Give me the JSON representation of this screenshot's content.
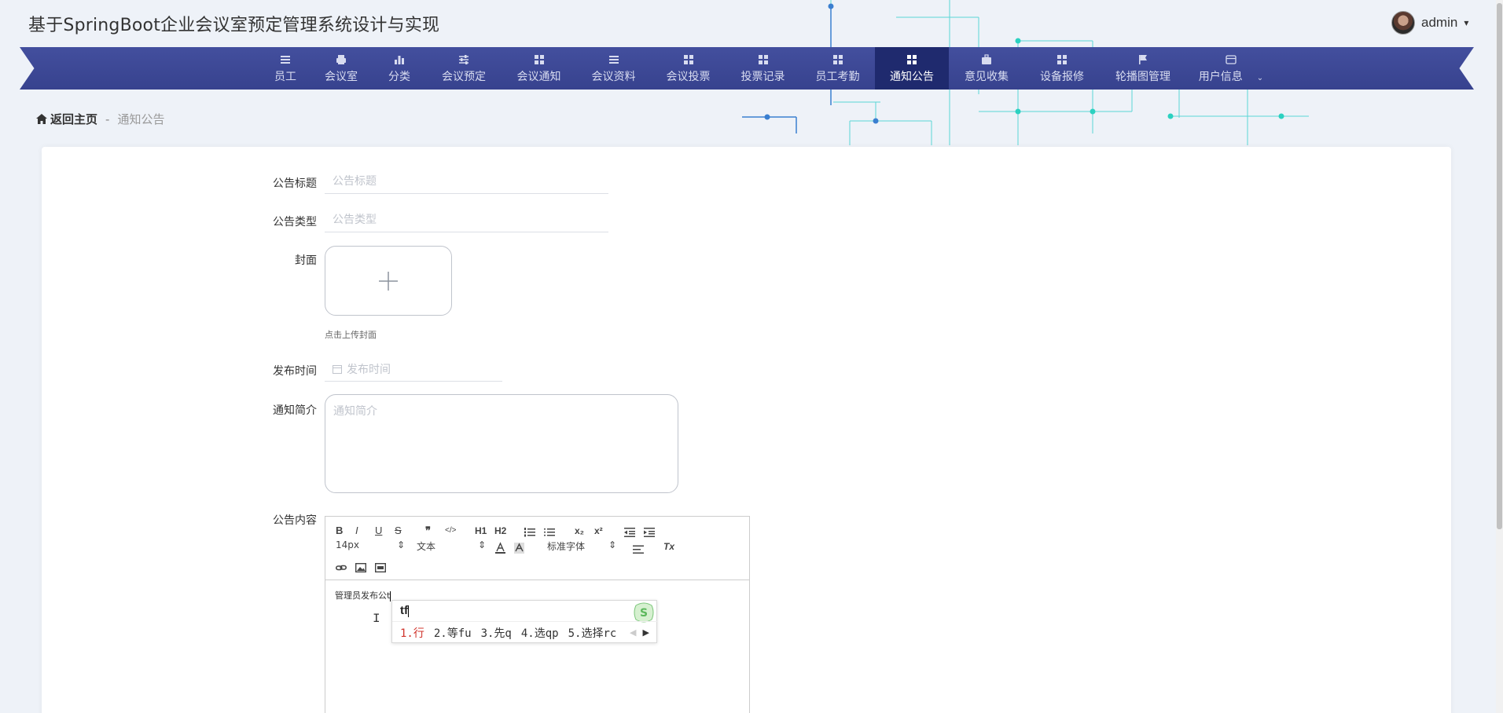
{
  "header": {
    "title": "基于SpringBoot企业会议室预定管理系统设计与实现",
    "user_name": "admin",
    "caret": "▾"
  },
  "nav": {
    "items": [
      {
        "label": "员工",
        "icon": "list-icon"
      },
      {
        "label": "会议室",
        "icon": "printer-icon"
      },
      {
        "label": "分类",
        "icon": "bar-chart-icon"
      },
      {
        "label": "会议预定",
        "icon": "sliders-icon"
      },
      {
        "label": "会议通知",
        "icon": "grid-icon"
      },
      {
        "label": "会议资料",
        "icon": "list-icon"
      },
      {
        "label": "会议投票",
        "icon": "grid-icon"
      },
      {
        "label": "投票记录",
        "icon": "grid-icon"
      },
      {
        "label": "员工考勤",
        "icon": "grid-icon"
      },
      {
        "label": "通知公告",
        "icon": "grid-icon",
        "active": true
      },
      {
        "label": "意见收集",
        "icon": "briefcase-icon"
      },
      {
        "label": "设备报修",
        "icon": "grid-icon"
      },
      {
        "label": "轮播图管理",
        "icon": "flag-icon"
      },
      {
        "label": "用户信息",
        "icon": "card-icon"
      }
    ],
    "active_color": "#1f2a6e",
    "bar_color": "#3b4794"
  },
  "breadcrumb": {
    "home": "返回主页",
    "separator": "-",
    "current": "通知公告"
  },
  "form": {
    "title_label": "公告标题",
    "title_placeholder": "公告标题",
    "type_label": "公告类型",
    "type_placeholder": "公告类型",
    "cover_label": "封面",
    "cover_hint": "点击上传封面",
    "time_label": "发布时间",
    "time_placeholder": "发布时间",
    "intro_label": "通知简介",
    "intro_placeholder": "通知简介",
    "content_label": "公告内容"
  },
  "editor": {
    "toolbar": {
      "bold": "B",
      "italic": "I",
      "underline": "U",
      "strike": "S",
      "quote": "❞",
      "code": "</>",
      "h1": "H1",
      "h2": "H2",
      "sub": "x₂",
      "sup": "x²",
      "size_value": "14px",
      "format_value": "文本",
      "font_value": "标准字体",
      "clean": "Tx"
    },
    "content_text": "管理员发布公t"
  },
  "ime": {
    "input": "tf",
    "candidates": [
      "1.行",
      "2.等fu",
      "3.先q",
      "4.选qp",
      "5.选择rc"
    ]
  }
}
